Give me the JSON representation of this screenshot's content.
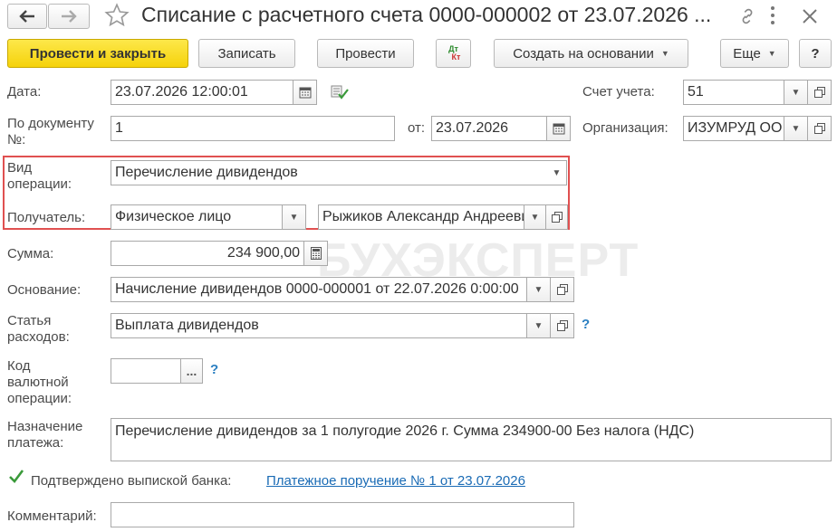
{
  "window": {
    "title": "Списание с расчетного счета 0000-000002 от 23.07.2026 ..."
  },
  "toolbar": {
    "post_close": "Провести и закрыть",
    "save": "Записать",
    "post": "Провести",
    "dt_kt_top": "Дт",
    "dt_kt_bottom": "Кт",
    "create_based": "Создать на основании",
    "more": "Еще",
    "help": "?"
  },
  "fields": {
    "date_label": "Дата:",
    "date_value": "23.07.2026 12:00:01",
    "account_label": "Счет учета:",
    "account_value": "51",
    "docnum_label": "По документу №:",
    "docnum_value": "1",
    "from_label": "от:",
    "from_value": "23.07.2026",
    "org_label": "Организация:",
    "org_value": "ИЗУМРУД ОО",
    "optype_label": "Вид операции:",
    "optype_value": "Перечисление дивидендов",
    "recipient_label": "Получатель:",
    "recipient_type": "Физическое лицо",
    "recipient_name": "Рыжиков Александр Андреевич",
    "sum_label": "Сумма:",
    "sum_value": "234 900,00",
    "basis_label": "Основание:",
    "basis_value": "Начисление дивидендов 0000-000001 от 22.07.2026 0:00:00",
    "expense_label": "Статья расходов:",
    "expense_value": "Выплата дивидендов",
    "currency_label": "Код валютной операции:",
    "currency_value": "",
    "currency_button": "...",
    "purpose_label": "Назначение платежа:",
    "purpose_value": "Перечисление дивидендов за 1 полугодие 2026 г. Сумма 234900-00 Без налога (НДС)",
    "confirmed_label": "Подтверждено выпиской банка:",
    "payment_link": "Платежное поручение № 1 от 23.07.2026",
    "comment_label": "Комментарий:",
    "comment_value": "",
    "help_mark": "?"
  },
  "watermark": "БУХЭКСПЕРТ",
  "colors": {
    "primary_button": "#f5d20b",
    "highlight_border": "#e05050",
    "link": "#1a6bb5",
    "check": "#3a9a3a"
  }
}
